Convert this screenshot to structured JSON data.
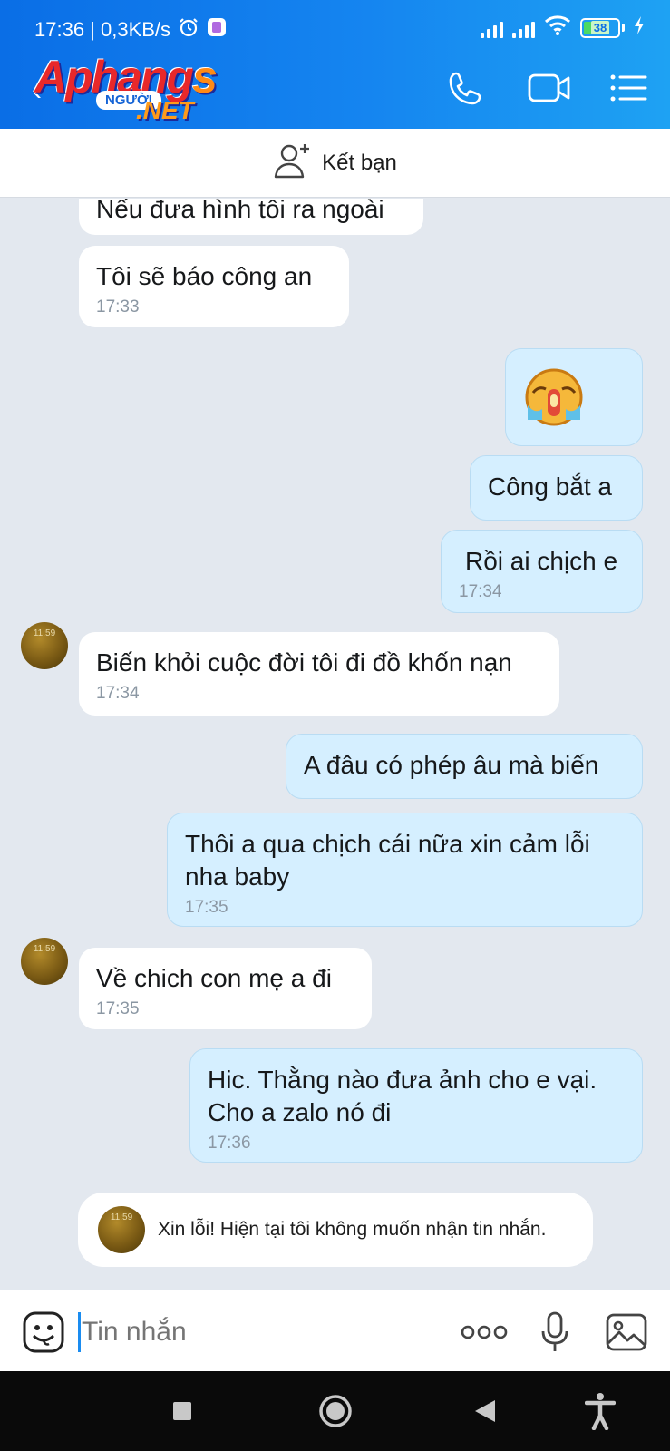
{
  "status": {
    "time_speed": "17:36 | 0,3KB/s",
    "battery": "38"
  },
  "header": {
    "logo_main_a": "Aphang",
    "logo_main_b": "s",
    "logo_sub": "NGƯỜI",
    "logo_net": ".NET"
  },
  "add_friend": {
    "label": "Kết bạn"
  },
  "messages": [
    {
      "text": "Nếu đưa hình tôi ra ngoài"
    },
    {
      "text": "Tôi sẽ báo công an",
      "time": "17:33"
    },
    {
      "text": "Công bắt a"
    },
    {
      "text": "Rồi ai chịch e",
      "time": "17:34"
    },
    {
      "text": "Biến khỏi cuộc đời tôi đi đồ khốn nạn",
      "time": "17:34"
    },
    {
      "text": "A đâu có phép âu mà biến"
    },
    {
      "text": "Thôi a qua chịch cái nữa xin cảm lỗi nha baby",
      "time": "17:35"
    },
    {
      "text": "Về chich con mẹ a đi",
      "time": "17:35"
    },
    {
      "text": "Hic. Thằng nào đưa ảnh cho e vại. Cho a zalo nó đi",
      "time": "17:36"
    }
  ],
  "avatar": {
    "time": "11:59"
  },
  "system_notice": "Xin lỗi! Hiện tại tôi không muốn nhận tin nhắn.",
  "composer": {
    "placeholder": "Tin nhắn"
  },
  "colors": {
    "header_start": "#0a6ee6",
    "header_end": "#1ea2f3",
    "bubble_out": "#d5efff",
    "bubble_in": "#ffffff",
    "chat_bg": "#e3e8ef"
  }
}
